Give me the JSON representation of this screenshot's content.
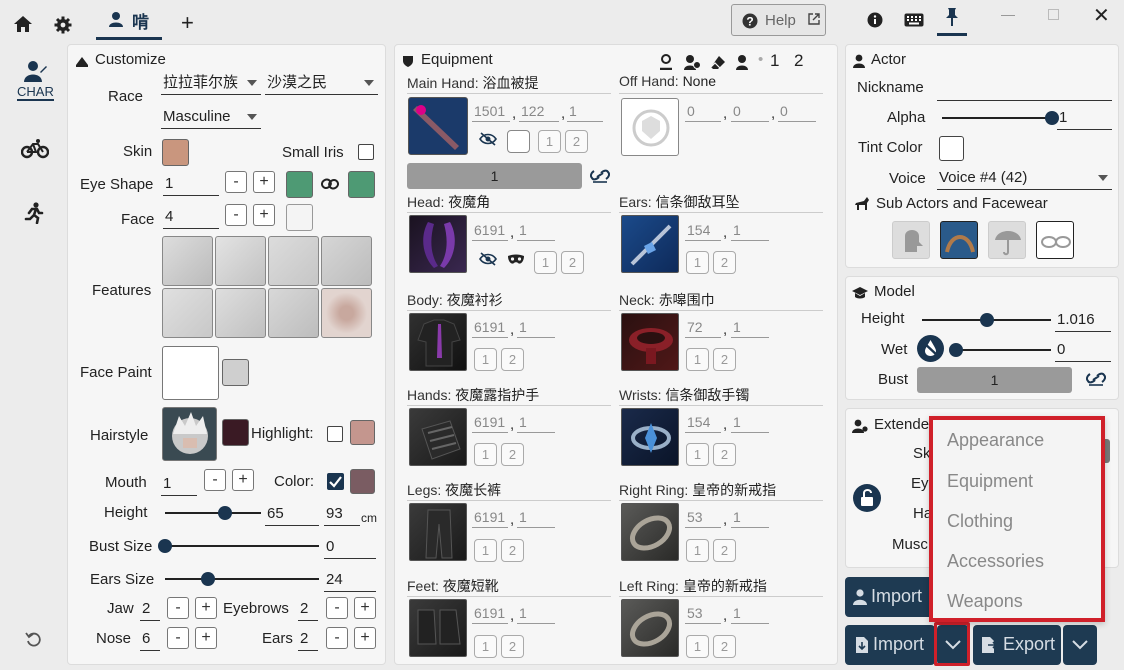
{
  "topbar": {
    "tab_label": "啃",
    "help_label": "Help",
    "window_controls": [
      "minimize",
      "maximize",
      "close"
    ]
  },
  "sidebar": {
    "items": [
      {
        "label": "CHAR",
        "icon": "character-icon"
      },
      {
        "label": "",
        "icon": "bicycle-icon"
      },
      {
        "label": "",
        "icon": "running-icon"
      },
      {
        "label": "",
        "icon": "undo-icon"
      }
    ]
  },
  "customize": {
    "title": "Customize",
    "race_label": "Race",
    "race_value": "拉拉菲尔族",
    "clan_value": "沙漠之民",
    "gender_value": "Masculine",
    "skin_label": "Skin",
    "skin_color": "#c9967e",
    "small_iris_label": "Small Iris",
    "eye_shape_label": "Eye Shape",
    "eye_shape_value": "1",
    "eye_color_1": "#4e9a74",
    "eye_color_2": "#4e9a74",
    "face_label": "Face",
    "face_value": "4",
    "face_color": "#f4f4f4",
    "features_label": "Features",
    "face_paint_label": "Face Paint",
    "face_paint_color": "#cfcfcf",
    "hairstyle_label": "Hairstyle",
    "hair_color": "#3a1a24",
    "highlight_label": "Highlight:",
    "highlight_color": "#c4968e",
    "mouth_label": "Mouth",
    "mouth_value": "1",
    "lip_color_label": "Color:",
    "lip_color": "#7a5c62",
    "height_label": "Height",
    "height_value": "65",
    "height_cm_value": "93",
    "height_unit": "cm",
    "height_fraction": 0.62,
    "bust_label": "Bust Size",
    "bust_value": "0",
    "bust_fraction": 0.0,
    "ears_size_label": "Ears Size",
    "ears_size_value": "24",
    "ears_size_fraction": 0.28,
    "jaw_label": "Jaw",
    "jaw_value": "2",
    "eyebrows_label": "Eyebrows",
    "eyebrows_value": "2",
    "nose_label": "Nose",
    "nose_value": "6",
    "ears_label": "Ears",
    "ears_value": "2"
  },
  "equipment": {
    "title": "Equipment",
    "dye_labels": [
      "1",
      "2"
    ],
    "main_hand": {
      "label": "Main Hand:",
      "name": "浴血被提",
      "v1": "1501",
      "v2": "122",
      "v3": "1",
      "dye1": "1",
      "dye2": "2",
      "bar_value": "1"
    },
    "off_hand": {
      "label": "Off Hand:",
      "name": "None",
      "v1": "0",
      "v2": "0",
      "v3": "0"
    },
    "head": {
      "label": "Head:",
      "name": "夜魔角",
      "v1": "6191",
      "v2": "1",
      "dye1": "1",
      "dye2": "2"
    },
    "ears": {
      "label": "Ears:",
      "name": "信条御敌耳坠",
      "v1": "154",
      "v2": "1",
      "dye1": "1",
      "dye2": "2"
    },
    "body": {
      "label": "Body:",
      "name": "夜魔衬衫",
      "v1": "6191",
      "v2": "1",
      "dye1": "1",
      "dye2": "2"
    },
    "neck": {
      "label": "Neck:",
      "name": "赤嗥围巾",
      "v1": "72",
      "v2": "1",
      "dye1": "1",
      "dye2": "2"
    },
    "hands": {
      "label": "Hands:",
      "name": "夜魔露指护手",
      "v1": "6191",
      "v2": "1",
      "dye1": "1",
      "dye2": "2"
    },
    "wrists": {
      "label": "Wrists:",
      "name": "信条御敌手镯",
      "v1": "154",
      "v2": "1",
      "dye1": "1",
      "dye2": "2"
    },
    "legs": {
      "label": "Legs:",
      "name": "夜魔长裤",
      "v1": "6191",
      "v2": "1",
      "dye1": "1",
      "dye2": "2"
    },
    "right_ring": {
      "label": "Right Ring:",
      "name": "皇帝的新戒指",
      "v1": "53",
      "v2": "1",
      "dye1": "1",
      "dye2": "2"
    },
    "feet": {
      "label": "Feet:",
      "name": "夜魔短靴",
      "v1": "6191",
      "v2": "1",
      "dye1": "1",
      "dye2": "2"
    },
    "left_ring": {
      "label": "Left Ring:",
      "name": "皇帝的新戒指",
      "v1": "53",
      "v2": "1",
      "dye1": "1",
      "dye2": "2"
    }
  },
  "actor": {
    "title": "Actor",
    "nickname_label": "Nickname",
    "nickname_value": "",
    "alpha_label": "Alpha",
    "alpha_value": "1",
    "alpha_fraction": 1.0,
    "tint_label": "Tint Color",
    "voice_label": "Voice",
    "voice_value": "Voice #4 (42)",
    "sub_actors_label": "Sub Actors and Facewear"
  },
  "model": {
    "title": "Model",
    "height_label": "Height",
    "height_value": "1.016",
    "height_fraction": 0.5,
    "wet_label": "Wet",
    "wet_value": "0",
    "wet_fraction": 0.0,
    "bust_label": "Bust",
    "bust_value": "1"
  },
  "extended": {
    "title": "Extende",
    "labels": [
      "Sk",
      "Ey",
      "Ha",
      "Musc"
    ]
  },
  "actions": {
    "import_top_label": "Import",
    "import_label": "Import",
    "export_label": "Export"
  },
  "import_menu": {
    "items": [
      "Appearance",
      "Equipment",
      "Clothing",
      "Accessories",
      "Weapons"
    ],
    "highlight_color": "#d0202a"
  }
}
